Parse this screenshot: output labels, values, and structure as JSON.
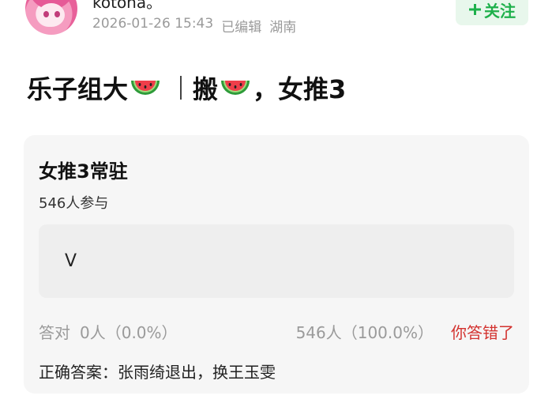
{
  "post": {
    "author": "kotona。",
    "date": "2026-01-26 15:43",
    "edited": "已编辑",
    "location": "湖南",
    "follow_label": "关注",
    "title_part1": "乐子组大",
    "title_part2": "搬",
    "title_part3": "，女推3"
  },
  "poll": {
    "title": "女推3常驻",
    "participants": "546人参与",
    "option_label": "V",
    "correct_label": "答对",
    "correct_stat": "0人（0.0%）",
    "option_stat": "546人（100.0%）",
    "wrong_label": "你答错了",
    "answer": "正确答案：张雨绮退出，换王玉雯"
  },
  "icons": {
    "plus": "plus-icon",
    "watermelon": "watermelon-emoji-icon"
  },
  "colors": {
    "follow_green": "#1eb04b",
    "follow_bg": "#e8f7ec",
    "wrong_red": "#d3322f",
    "card_bg": "#f6f6f6"
  }
}
